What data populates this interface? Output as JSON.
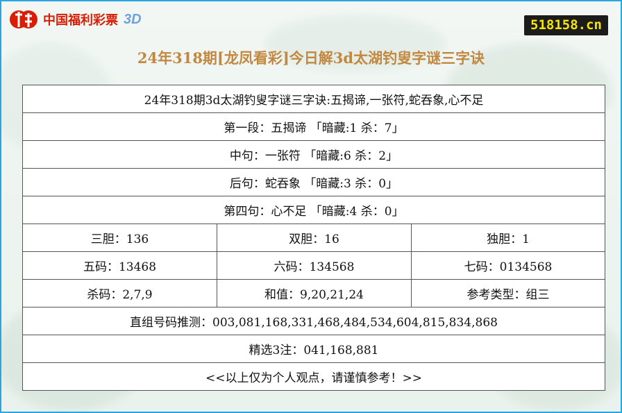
{
  "brand": {
    "logo_text": "中国福利彩票",
    "logo_3d": "3D",
    "site_badge": "518158.cn"
  },
  "page_title": "24年318期[龙凤看彩]今日解3d太湖钓叟字谜三字诀",
  "table": {
    "header": "24年318期3d太湖钓叟字谜三字诀:五揭谛,一张符,蛇吞象,心不足",
    "segments": [
      "第一段：五揭谛 「暗藏:1 杀：7」",
      "中句：一张符 「暗藏:6 杀：2」",
      "后句：蛇吞象 「暗藏:3 杀：0」",
      "第四句：心不足 「暗藏:4 杀：0」"
    ],
    "row_dan": [
      "三胆：136",
      "双胆：16",
      "独胆：1"
    ],
    "row_codes": [
      "五码：13468",
      "六码：134568",
      "七码：0134568"
    ],
    "row_kill": [
      "杀码：2,7,9",
      "和值：9,20,21,24",
      "参考类型：组三"
    ],
    "direct_guess": "直组号码推测：003,081,168,331,468,484,534,604,815,834,868",
    "selected": "精选3注：041,168,881",
    "footer": "<<以上仅为个人观点，请谨慎参考！>>"
  },
  "colors": {
    "frame_border": "#29a6e0",
    "title": "#c2883f",
    "logo_red": "#d81e06",
    "logo_3d_blue": "#6fa2d8",
    "badge_bg": "#1c1c1c",
    "badge_text": "#f7e500"
  }
}
